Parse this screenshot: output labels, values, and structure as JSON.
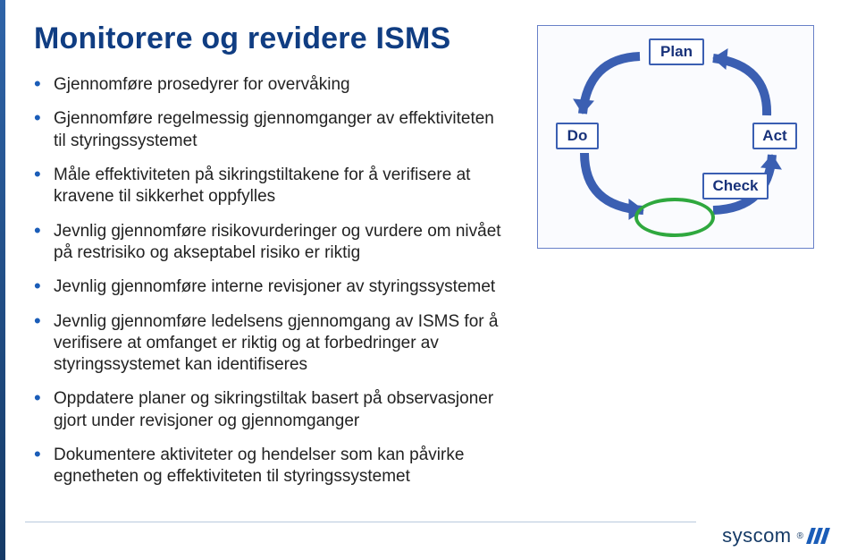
{
  "title": "Monitorere og revidere ISMS",
  "bullets": [
    "Gjennomføre prosedyrer for overvåking",
    "Gjennomføre regelmessig gjennomganger av effektiviteten til styringssystemet",
    "Måle effektiviteten på sikringstiltakene for å verifisere at kravene til sikkerhet oppfylles",
    "Jevnlig gjennomføre risikovurderinger og vurdere om nivået på restrisiko og akseptabel risiko er riktig",
    "Jevnlig gjennomføre interne revisjoner av styringssystemet",
    "Jevnlig gjennomføre ledelsens gjennomgang av ISMS for å verifisere at omfanget er riktig og at forbedringer av styringssystemet kan identifiseres",
    "Oppdatere planer og sikringstiltak basert på observasjoner gjort under revisjoner og gjennomganger",
    "Dokumentere aktiviteter og hendelser som kan påvirke egnetheten og effektiviteten til styringssystemet"
  ],
  "pdca": {
    "plan": "Plan",
    "do": "Do",
    "check": "Check",
    "act": "Act"
  },
  "logo_text": "syscom",
  "chart_data": {
    "type": "diagram",
    "cycle": [
      "Plan",
      "Do",
      "Check",
      "Act"
    ],
    "highlighted_phase": "Check",
    "arrows": [
      {
        "from": "Plan",
        "to": "Do"
      },
      {
        "from": "Do",
        "to": "Check"
      },
      {
        "from": "Check",
        "to": "Act"
      },
      {
        "from": "Act",
        "to": "Plan"
      }
    ],
    "title": "PDCA cycle"
  }
}
